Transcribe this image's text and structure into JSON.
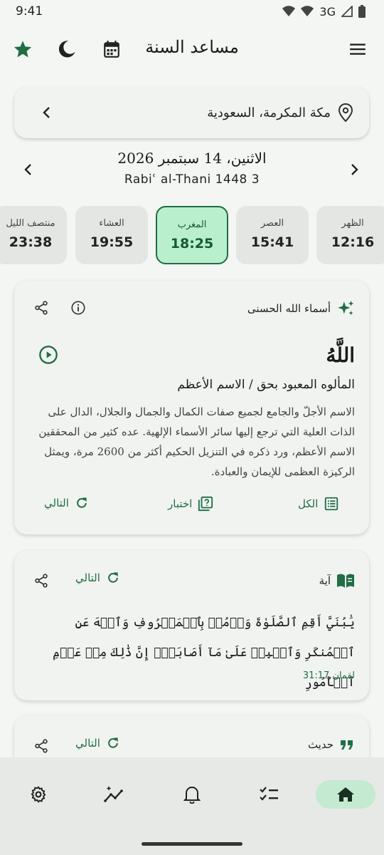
{
  "status": {
    "time": "9:41",
    "network": "3G"
  },
  "app": {
    "title": "مساعد السنة"
  },
  "location": {
    "label": "مكة المكرمة، السعودية"
  },
  "date": {
    "gregorian": "الاثنين، 14 سبتمبر 2026",
    "hijri": "Rabiʿ al-Thani 1448 3"
  },
  "prayers": [
    {
      "name": "منتصف الليل",
      "time": "23:38",
      "active": false
    },
    {
      "name": "العشاء",
      "time": "19:55",
      "active": false
    },
    {
      "name": "المغرب",
      "time": "18:25",
      "active": true
    },
    {
      "name": "العصر",
      "time": "15:41",
      "active": false
    },
    {
      "name": "الظهر",
      "time": "12:16",
      "active": false
    }
  ],
  "names_card": {
    "title": "أسماء الله الحسنى",
    "name": "اللَّهُ",
    "meaning": "المألوه المعبود بحق / الاسم الأعظم",
    "description": "الاسم الأجلّ والجامع لجميع صفات الكمال والجمال والجلال، الدال على الذات العلية التي ترجع إليها سائر الأسماء الإلهية. عده كثير من المحققين الاسم الأعظم، ورد ذكره في التنزيل الحكيم أكثر من 2600 مرة، ويمثل الركيزة العظمى للإيمان والعبادة.",
    "actions": {
      "all": "الكل",
      "quiz": "اختبار",
      "next": "التالي"
    }
  },
  "ayah_card": {
    "title": "آية",
    "next": "التالي",
    "text": "يَٰبُنَيَّ أَقِمِ ٱلصَّلَوٰةَ وَأۡمُرۡ بِٱلۡمَعۡرُوفِ وَٱنۡهَ عَنِ ٱلۡمُنكَرِ وَٱصۡبِرۡ عَلَىٰ مَآ أَصَابَكَۖ إِنَّ ذَٰلِكَ مِنۡ عَزۡمِ ٱلۡأُمُورِ",
    "reference": "لقمان 31:17"
  },
  "hadith_card": {
    "title": "حديث",
    "next": "التالي"
  },
  "colors": {
    "accent": "#1f6e45",
    "active_prayer_bg": "#b9efcd",
    "background": "#f4f6f4"
  }
}
